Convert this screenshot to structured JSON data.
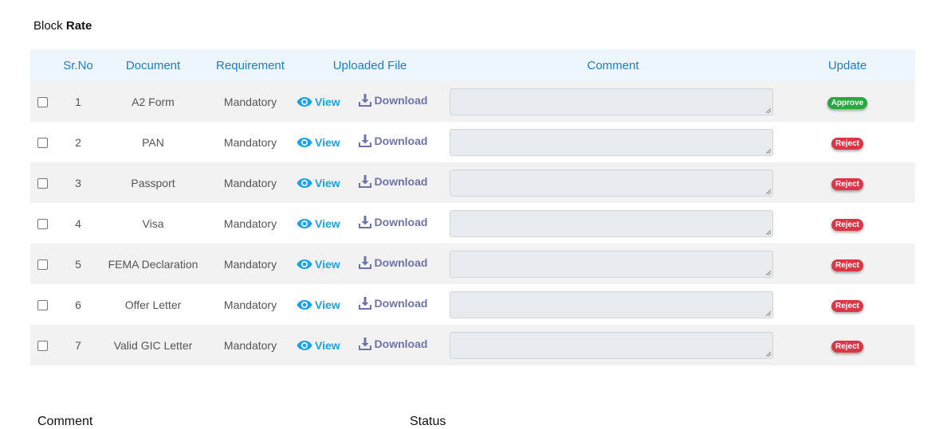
{
  "block": {
    "prefix": "Block",
    "bold": "Rate"
  },
  "columns": [
    "Sr.No",
    "Document",
    "Requirement",
    "Uploaded File",
    "Comment",
    "Update"
  ],
  "view_label": "View",
  "download_label": "Download",
  "rows": [
    {
      "sr": "1",
      "document": "A2 Form",
      "requirement": "Mandatory",
      "comment": "",
      "status": "Approve",
      "status_color": "#28a745"
    },
    {
      "sr": "2",
      "document": "PAN",
      "requirement": "Mandatory",
      "comment": "",
      "status": "Reject",
      "status_color": "#dc3545"
    },
    {
      "sr": "3",
      "document": "Passport",
      "requirement": "Mandatory",
      "comment": "",
      "status": "Reject",
      "status_color": "#dc3545"
    },
    {
      "sr": "4",
      "document": "Visa",
      "requirement": "Mandatory",
      "comment": "",
      "status": "Reject",
      "status_color": "#dc3545"
    },
    {
      "sr": "5",
      "document": "FEMA Declaration",
      "requirement": "Mandatory",
      "comment": "",
      "status": "Reject",
      "status_color": "#dc3545"
    },
    {
      "sr": "6",
      "document": "Offer Letter",
      "requirement": "Mandatory",
      "comment": "",
      "status": "Reject",
      "status_color": "#dc3545"
    },
    {
      "sr": "7",
      "document": "Valid GIC Letter",
      "requirement": "Mandatory",
      "comment": "",
      "status": "Reject",
      "status_color": "#dc3545"
    }
  ],
  "footer": {
    "comment_label": "Comment",
    "status_label": "Status"
  },
  "colors": {
    "header_text": "#1a7fc4",
    "header_bg": "#eef6fd",
    "view": "#1aa3e8",
    "download": "#6e73a8"
  }
}
